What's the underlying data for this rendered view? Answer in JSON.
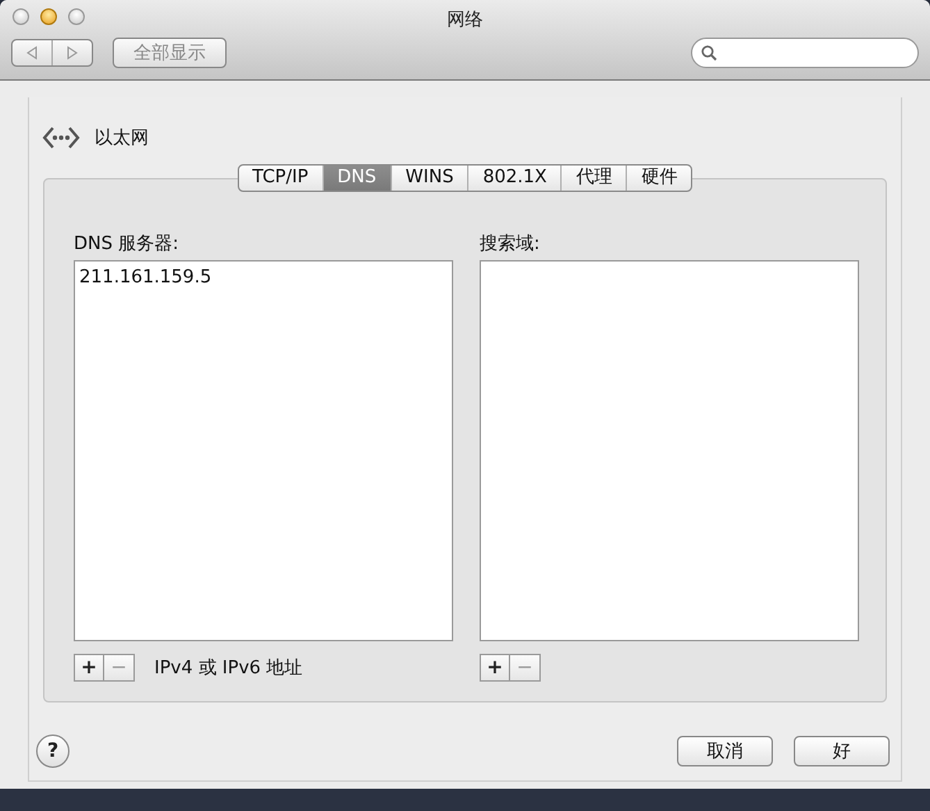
{
  "window": {
    "title": "网络"
  },
  "toolbar": {
    "show_all": "全部显示"
  },
  "service": {
    "name": "以太网"
  },
  "tabs": [
    {
      "label": "TCP/IP",
      "selected": false
    },
    {
      "label": "DNS",
      "selected": true
    },
    {
      "label": "WINS",
      "selected": false
    },
    {
      "label": "802.1X",
      "selected": false
    },
    {
      "label": "代理",
      "selected": false
    },
    {
      "label": "硬件",
      "selected": false
    }
  ],
  "lists": [
    {
      "label": "DNS 服务器:",
      "entries": [
        "211.161.159.5"
      ],
      "buttons": [
        {
          "label": "+",
          "disabled": false
        },
        {
          "label": "−",
          "disabled": true
        }
      ],
      "hint": "IPv4 或 IPv6 地址"
    },
    {
      "label": "搜索域:",
      "buttons": [
        {
          "label": "+",
          "disabled": false
        },
        {
          "label": "−",
          "disabled": true
        }
      ]
    }
  ],
  "footer": {
    "help": "?",
    "buttons": [
      "取消",
      "好"
    ]
  }
}
